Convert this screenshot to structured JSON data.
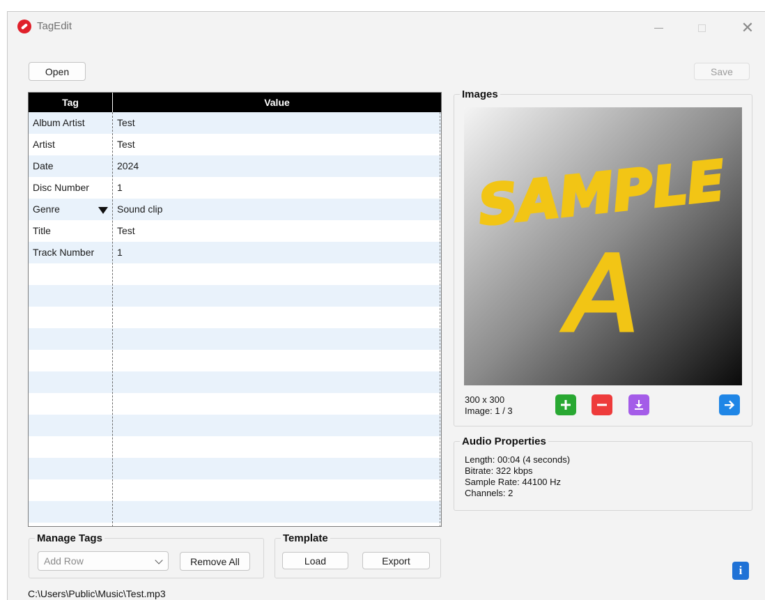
{
  "window": {
    "title": "TagEdit",
    "minimize_label": "",
    "close_label": "✕"
  },
  "toolbar": {
    "open_label": "Open",
    "save_label": "Save"
  },
  "table": {
    "headers": {
      "tag": "Tag",
      "value": "Value"
    },
    "rows": [
      {
        "tag": "Album Artist",
        "value": "Test"
      },
      {
        "tag": "Artist",
        "value": "Test"
      },
      {
        "tag": "Date",
        "value": "2024"
      },
      {
        "tag": "Disc Number",
        "value": "1"
      },
      {
        "tag": "Genre",
        "value": "Sound clip"
      },
      {
        "tag": "Title",
        "value": "Test"
      },
      {
        "tag": "Track Number",
        "value": "1"
      }
    ]
  },
  "images": {
    "label": "Images",
    "resolution": "300 x 300",
    "index_text": "Image: 1 / 3",
    "artwork_text_top": "SAMPLE",
    "artwork_text_bottom": "A",
    "colors": {
      "add": "#29a832",
      "remove": "#ee3b3b",
      "download": "#a45ce8",
      "next": "#1f86e6",
      "artwork_ink": "#f2c515"
    }
  },
  "audio": {
    "label": "Audio Properties",
    "length": "Length: 00:04 (4 seconds)",
    "bitrate": "Bitrate: 322 kbps",
    "sample_rate": "Sample Rate: 44100 Hz",
    "channels": "Channels: 2"
  },
  "manage_tags": {
    "label": "Manage Tags",
    "add_row_placeholder": "Add Row",
    "remove_all_label": "Remove All"
  },
  "template": {
    "label": "Template",
    "load_label": "Load",
    "export_label": "Export"
  },
  "info_label": "i",
  "status": {
    "file_path": "C:\\Users\\Public\\Music\\Test.mp3"
  }
}
